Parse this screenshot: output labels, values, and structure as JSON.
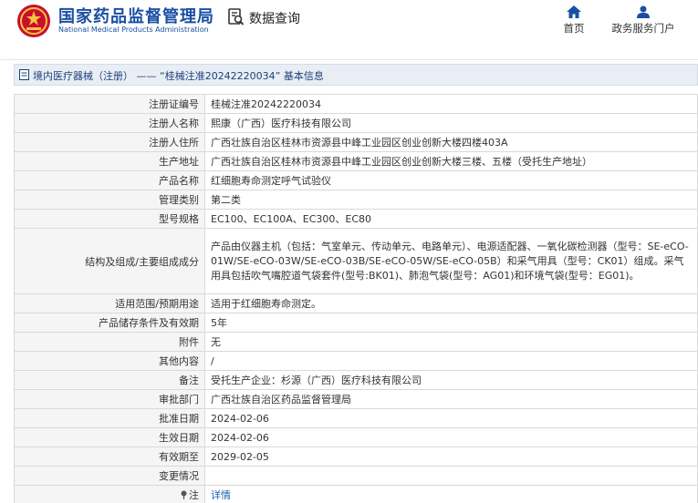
{
  "header": {
    "brand_cn": "国家药品监督管理局",
    "brand_en": "National Medical Products Administration",
    "query_label": "数据查询",
    "nav": [
      {
        "label": "首页",
        "icon": "home-icon"
      },
      {
        "label": "政务服务门户",
        "icon": "user-icon"
      }
    ]
  },
  "section": {
    "title": "境内医疗器械（注册） —— “桂械注准20242220034” 基本信息"
  },
  "rows": [
    {
      "label": "注册证编号",
      "value": "桂械注准20242220034"
    },
    {
      "label": "注册人名称",
      "value": "熙康（广西）医疗科技有限公司"
    },
    {
      "label": "注册人住所",
      "value": "广西壮族自治区桂林市资源县中峰工业园区创业创新大楼四楼403A"
    },
    {
      "label": "生产地址",
      "value": "广西壮族自治区桂林市资源县中峰工业园区创业创新大楼三楼、五楼（受托生产地址）"
    },
    {
      "label": "产品名称",
      "value": "红细胞寿命测定呼气试验仪"
    },
    {
      "label": "管理类别",
      "value": "第二类"
    },
    {
      "label": "型号规格",
      "value": "EC100、EC100A、EC300、EC80"
    },
    {
      "label": "结构及组成/主要组成成分",
      "value": "产品由仪器主机（包括：气室单元、传动单元、电路单元）、电源适配器、一氧化碳检测器（型号：SE-eCO-01W/SE-eCO-03W/SE-eCO-03B/SE-eCO-05W/SE-eCO-05B）和采气用具（型号：CK01）组成。采气用具包括吹气嘴腔道气袋套件(型号:BK01)、肺泡气袋(型号：AG01)和环境气袋(型号：EG01)。"
    },
    {
      "label": "适用范围/预期用途",
      "value": "适用于红细胞寿命测定。"
    },
    {
      "label": "产品储存条件及有效期",
      "value": "5年"
    },
    {
      "label": "附件",
      "value": "无"
    },
    {
      "label": "其他内容",
      "value": "/"
    },
    {
      "label": "备注",
      "value": "受托生产企业：杉源（广西）医疗科技有限公司"
    },
    {
      "label": "审批部门",
      "value": "广西壮族自治区药品监督管理局"
    },
    {
      "label": "批准日期",
      "value": "2024-02-06"
    },
    {
      "label": "生效日期",
      "value": "2024-02-06"
    },
    {
      "label": "有效期至",
      "value": "2029-02-05"
    },
    {
      "label": "变更情况",
      "value": ""
    }
  ],
  "note_row": {
    "label": "注",
    "link": "详情",
    "icon": "pin-icon"
  },
  "colors": {
    "brand_blue": "#1a4fa3",
    "link_blue": "#1a5fb4",
    "section_bg": "#e9eef5"
  }
}
